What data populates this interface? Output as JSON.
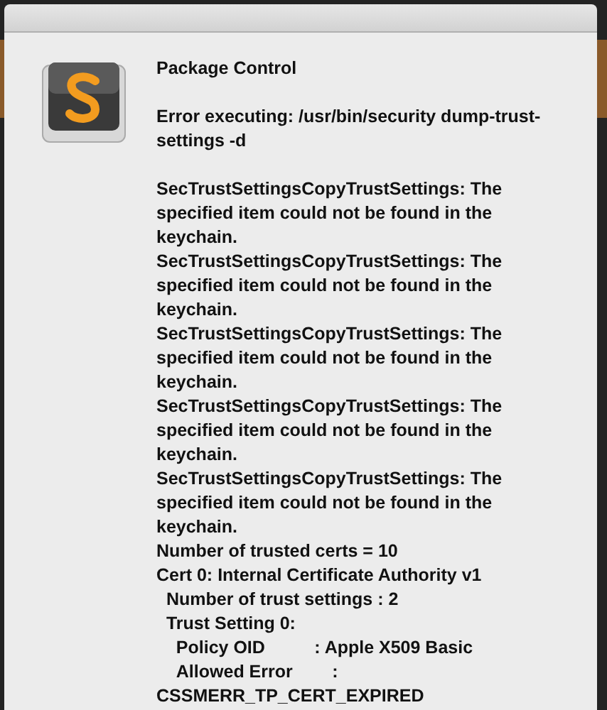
{
  "dialog": {
    "title": "Package Control",
    "message": "Error executing: /usr/bin/security dump-trust-settings -d",
    "output": [
      "SecTrustSettingsCopyTrustSettings: The specified item could not be found in the keychain.",
      "SecTrustSettingsCopyTrustSettings: The specified item could not be found in the keychain.",
      "SecTrustSettingsCopyTrustSettings: The specified item could not be found in the keychain.",
      "SecTrustSettingsCopyTrustSettings: The specified item could not be found in the keychain.",
      "SecTrustSettingsCopyTrustSettings: The specified item could not be found in the keychain.",
      "Number of trusted certs = 10",
      "Cert 0: Internal Certificate Authority v1",
      "  Number of trust settings : 2",
      "  Trust Setting 0:",
      "    Policy OID          : Apple X509 Basic",
      "    Allowed Error        :",
      "CSSMERR_TP_CERT_EXPIRED"
    ]
  }
}
